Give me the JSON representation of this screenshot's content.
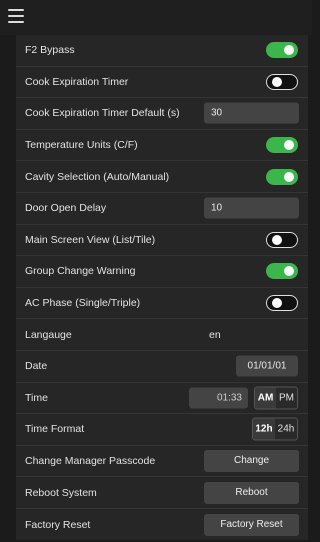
{
  "menu_icon": "hamburger-menu-icon",
  "accent_color": "#3cb54c",
  "rows": {
    "f2_bypass": {
      "label": "F2 Bypass",
      "toggle": true
    },
    "cook_expiration_timer": {
      "label": "Cook Expiration Timer",
      "toggle": false
    },
    "cook_expiration_timer_default": {
      "label": "Cook Expiration Timer Default (s)",
      "value": "30"
    },
    "temperature_units": {
      "label": "Temperature Units (C/F)",
      "toggle": true
    },
    "cavity_selection": {
      "label": "Cavity Selection (Auto/Manual)",
      "toggle": true
    },
    "door_open_delay": {
      "label": "Door Open Delay",
      "value": "10"
    },
    "main_screen_view": {
      "label": "Main Screen View (List/Tile)",
      "toggle": false
    },
    "group_change_warning": {
      "label": "Group Change Warning",
      "toggle": true
    },
    "ac_phase": {
      "label": "AC Phase (Single/Triple)",
      "toggle": false
    },
    "language": {
      "label": "Langauge",
      "value": "en"
    },
    "date": {
      "label": "Date",
      "value": "01/01/01"
    },
    "time": {
      "label": "Time",
      "value": "01:33",
      "am_label": "AM",
      "pm_label": "PM",
      "selected": "AM"
    },
    "time_format": {
      "label": "Time Format",
      "label_12h": "12h",
      "label_24h": "24h",
      "selected": "12h"
    },
    "change_manager_passcode": {
      "label": "Change Manager Passcode",
      "button": "Change"
    },
    "reboot_system": {
      "label": "Reboot System",
      "button": "Reboot"
    },
    "factory_reset": {
      "label": "Factory Reset",
      "button": "Factory Reset"
    }
  }
}
